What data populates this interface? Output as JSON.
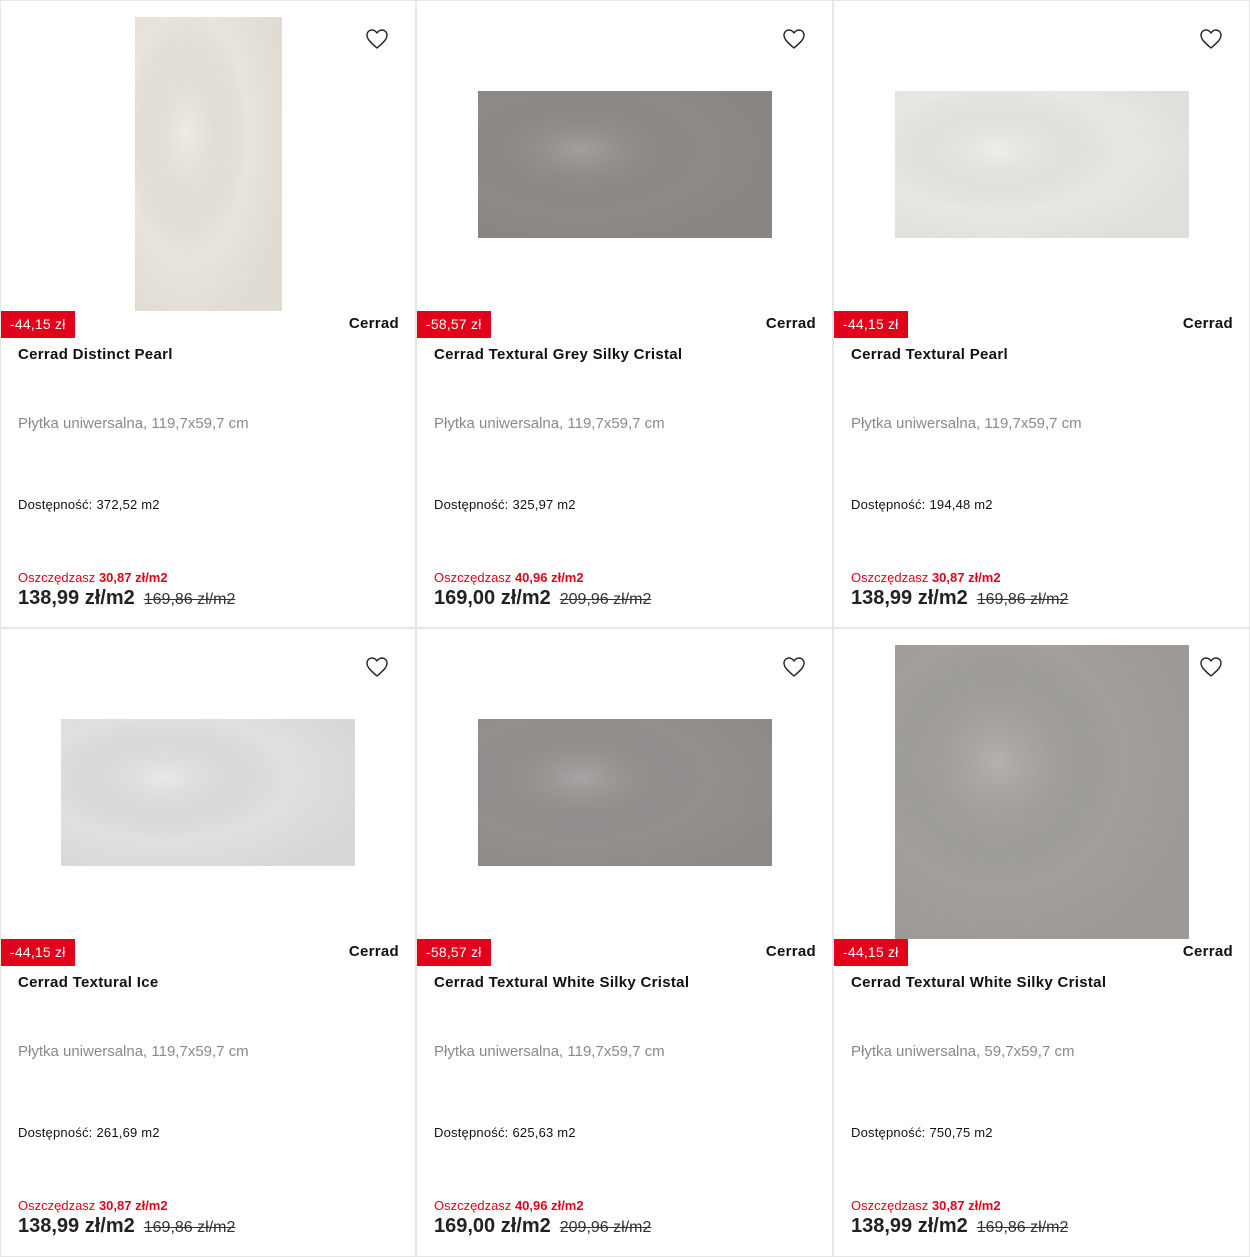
{
  "colors": {
    "accent_red": "#e2001a",
    "border": "#e6e6e6",
    "muted_text": "#8a8a8a"
  },
  "products": [
    {
      "discount": "-44,15 zł",
      "brand": "Cerrad",
      "name": "Cerrad Distinct Pearl",
      "desc": "Płytka uniwersalna, 119,7x59,7 cm",
      "avail_label": "Dostępność:",
      "avail_value": "372,52 m2",
      "save_label": "Oszczędzasz",
      "save_value": "30,87 zł/m2",
      "price": "138,99 zł/m2",
      "old_price": "169,86 zł/m2",
      "tile_color": "#ece8df",
      "tile_shape": "rect-v"
    },
    {
      "discount": "-58,57 zł",
      "brand": "Cerrad",
      "name": "Cerrad Textural Grey Silky Cristal",
      "desc": "Płytka uniwersalna, 119,7x59,7 cm",
      "avail_label": "Dostępność:",
      "avail_value": "325,97 m2",
      "save_label": "Oszczędzasz",
      "save_value": "40,96 zł/m2",
      "price": "169,00 zł/m2",
      "old_price": "209,96 zł/m2",
      "tile_color": "#8f8c89",
      "tile_shape": "rect-h"
    },
    {
      "discount": "-44,15 zł",
      "brand": "Cerrad",
      "name": "Cerrad Textural Pearl",
      "desc": "Płytka uniwersalna, 119,7x59,7 cm",
      "avail_label": "Dostępność:",
      "avail_value": "194,48 m2",
      "save_label": "Oszczędzasz",
      "save_value": "30,87 zł/m2",
      "price": "138,99 zł/m2",
      "old_price": "169,86 zł/m2",
      "tile_color": "#ecebe6",
      "tile_shape": "rect-h"
    },
    {
      "discount": "-44,15 zł",
      "brand": "Cerrad",
      "name": "Cerrad Textural Ice",
      "desc": "Płytka uniwersalna, 119,7x59,7 cm",
      "avail_label": "Dostępność:",
      "avail_value": "261,69 m2",
      "save_label": "Oszczędzasz",
      "save_value": "30,87 zł/m2",
      "price": "138,99 zł/m2",
      "old_price": "169,86 zł/m2",
      "tile_color": "#e3e4e6",
      "tile_shape": "rect-h"
    },
    {
      "discount": "-58,57 zł",
      "brand": "Cerrad",
      "name": "Cerrad Textural White Silky Cristal",
      "desc": "Płytka uniwersalna, 119,7x59,7 cm",
      "avail_label": "Dostępność:",
      "avail_value": "625,63 m2",
      "save_label": "Oszczędzasz",
      "save_value": "40,96 zł/m2",
      "price": "169,00 zł/m2",
      "old_price": "209,96 zł/m2",
      "tile_color": "#959290",
      "tile_shape": "rect-h"
    },
    {
      "discount": "-44,15 zł",
      "brand": "Cerrad",
      "name": "Cerrad Textural White Silky Cristal",
      "desc": "Płytka uniwersalna, 59,7x59,7 cm",
      "avail_label": "Dostępność:",
      "avail_value": "750,75 m2",
      "save_label": "Oszczędzasz",
      "save_value": "30,87 zł/m2",
      "price": "138,99 zł/m2",
      "old_price": "169,86 zł/m2",
      "tile_color": "#a4a19e",
      "tile_shape": "square"
    }
  ]
}
